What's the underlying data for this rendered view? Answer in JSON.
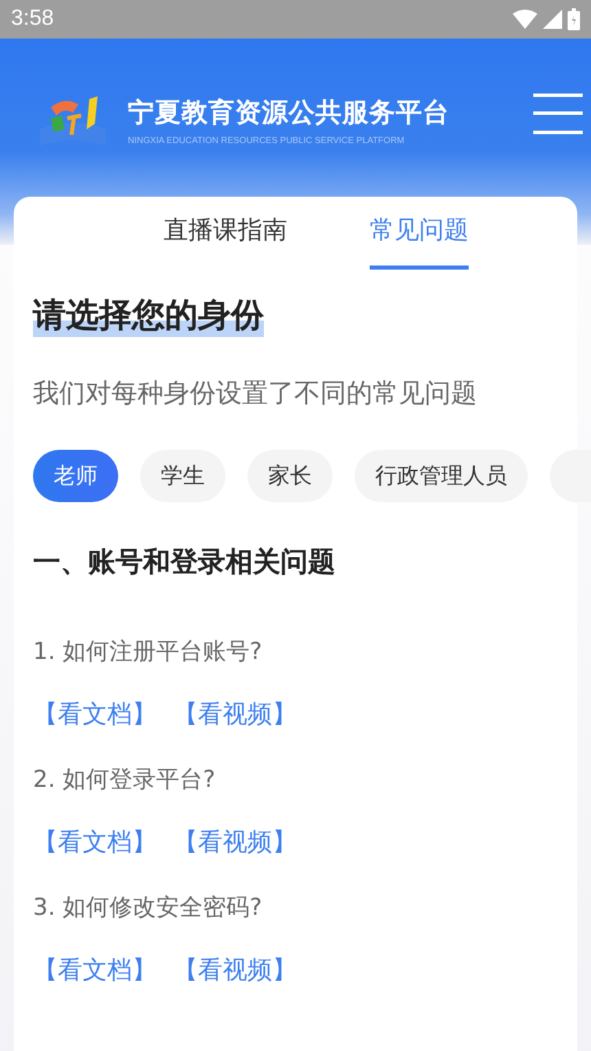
{
  "status_bar": {
    "time": "3:58"
  },
  "header": {
    "title": "宁夏教育资源公共服务平台",
    "subtitle": "NINGXIA EDUCATION RESOURCES PUBLIC SERVICE PLATFORM"
  },
  "tabs": [
    {
      "label": "直播课指南",
      "selected": false
    },
    {
      "label": "常见问题",
      "selected": true
    }
  ],
  "heading": "请选择您的身份",
  "description": "我们对每种身份设置了不同的常见问题",
  "roles": [
    {
      "label": "老师",
      "selected": true
    },
    {
      "label": "学生",
      "selected": false
    },
    {
      "label": "家长",
      "selected": false
    },
    {
      "label": "行政管理人员",
      "selected": false
    }
  ],
  "section_title": "一、账号和登录相关问题",
  "questions": [
    {
      "text": "1. 如何注册平台账号?",
      "links": [
        "【看文档】",
        "【看视频】"
      ]
    },
    {
      "text": "2. 如何登录平台?",
      "links": [
        "【看文档】",
        "【看视频】"
      ]
    },
    {
      "text": "3. 如何修改安全密码?",
      "links": [
        "【看文档】",
        "【看视频】"
      ]
    }
  ]
}
